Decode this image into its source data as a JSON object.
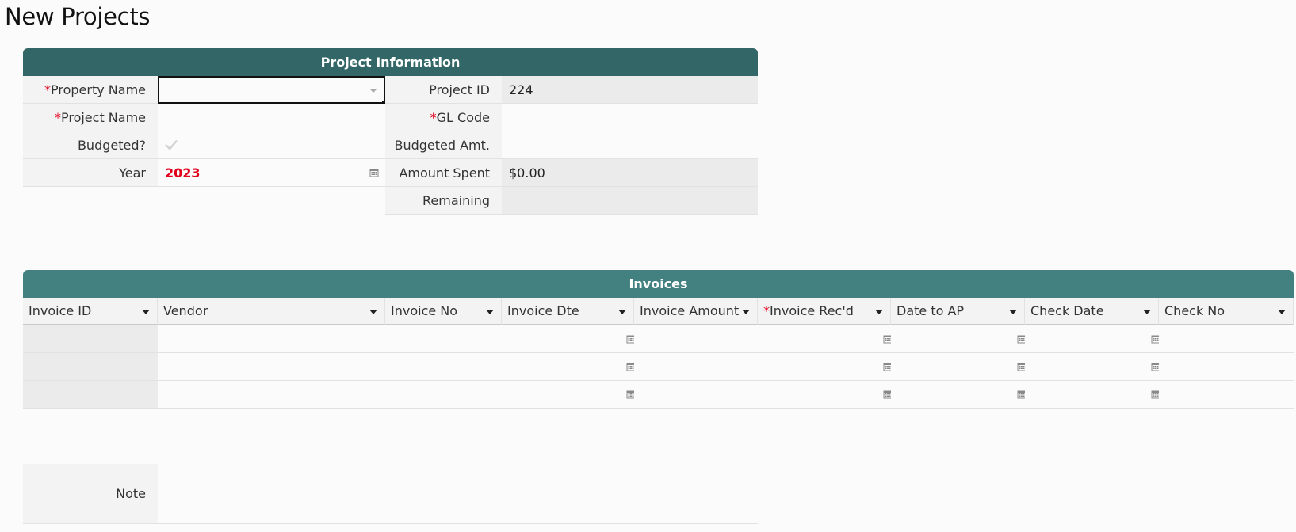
{
  "page": {
    "title": "New Projects"
  },
  "project_info": {
    "header": "Project Information",
    "required_mark": "*",
    "property_name": {
      "label": "Property Name",
      "value": ""
    },
    "project_name": {
      "label": "Project Name",
      "value": ""
    },
    "budgeted": {
      "label": "Budgeted?",
      "checked": false
    },
    "year": {
      "label": "Year",
      "value": "2023"
    },
    "project_id": {
      "label": "Project ID",
      "value": "224"
    },
    "gl_code": {
      "label": "GL Code",
      "value": ""
    },
    "budgeted_amt": {
      "label": "Budgeted Amt.",
      "value": ""
    },
    "amount_spent": {
      "label": "Amount Spent",
      "value": "$0.00"
    },
    "remaining": {
      "label": "Remaining",
      "value": ""
    }
  },
  "invoices": {
    "header": "Invoices",
    "columns": [
      {
        "label": "Invoice ID",
        "required": false
      },
      {
        "label": "Vendor",
        "required": false
      },
      {
        "label": "Invoice No",
        "required": false
      },
      {
        "label": "Invoice Dte",
        "required": false
      },
      {
        "label": "Invoice Amount",
        "required": false
      },
      {
        "label": "Invoice Rec'd",
        "required": true
      },
      {
        "label": "Date to AP",
        "required": false
      },
      {
        "label": "Check Date",
        "required": false
      },
      {
        "label": "Check No",
        "required": false
      }
    ],
    "rows": [
      [
        "",
        "",
        "",
        "",
        "",
        "",
        "",
        "",
        ""
      ],
      [
        "",
        "",
        "",
        "",
        "",
        "",
        "",
        "",
        ""
      ],
      [
        "",
        "",
        "",
        "",
        "",
        "",
        "",
        "",
        ""
      ]
    ]
  },
  "note": {
    "label": "Note",
    "value": ""
  },
  "icons": {
    "calendar": "calendar-icon",
    "checkmark": "checkmark-icon",
    "dropdown": "chevron-down-icon"
  },
  "colors": {
    "header": "#336767",
    "invoice_header": "#438181",
    "required": "#e0001b"
  }
}
